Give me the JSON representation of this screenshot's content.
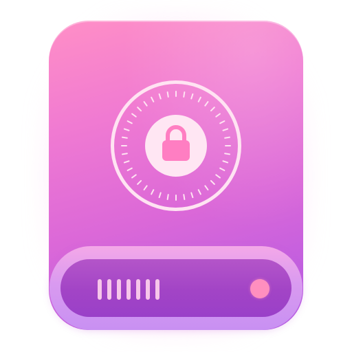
{
  "icon": {
    "name": "encrypted-drive-icon",
    "colors": {
      "body_top": "#ff8fc6",
      "body_bottom": "#b35ee6",
      "dial_ring": "#ffe3f2",
      "lock": "#ff7ec2",
      "tray_outer": "#d99af0",
      "tray_inner": "#a244c6",
      "vent": "#f7c6ea",
      "status_led": "#ff8fbf"
    },
    "parts": {
      "dial": "combination-dial-icon",
      "lock": "padlock-icon",
      "vent": "vent-slots",
      "led": "status-led"
    },
    "vent_slot_count": 7,
    "dial_tick_count": 40
  }
}
